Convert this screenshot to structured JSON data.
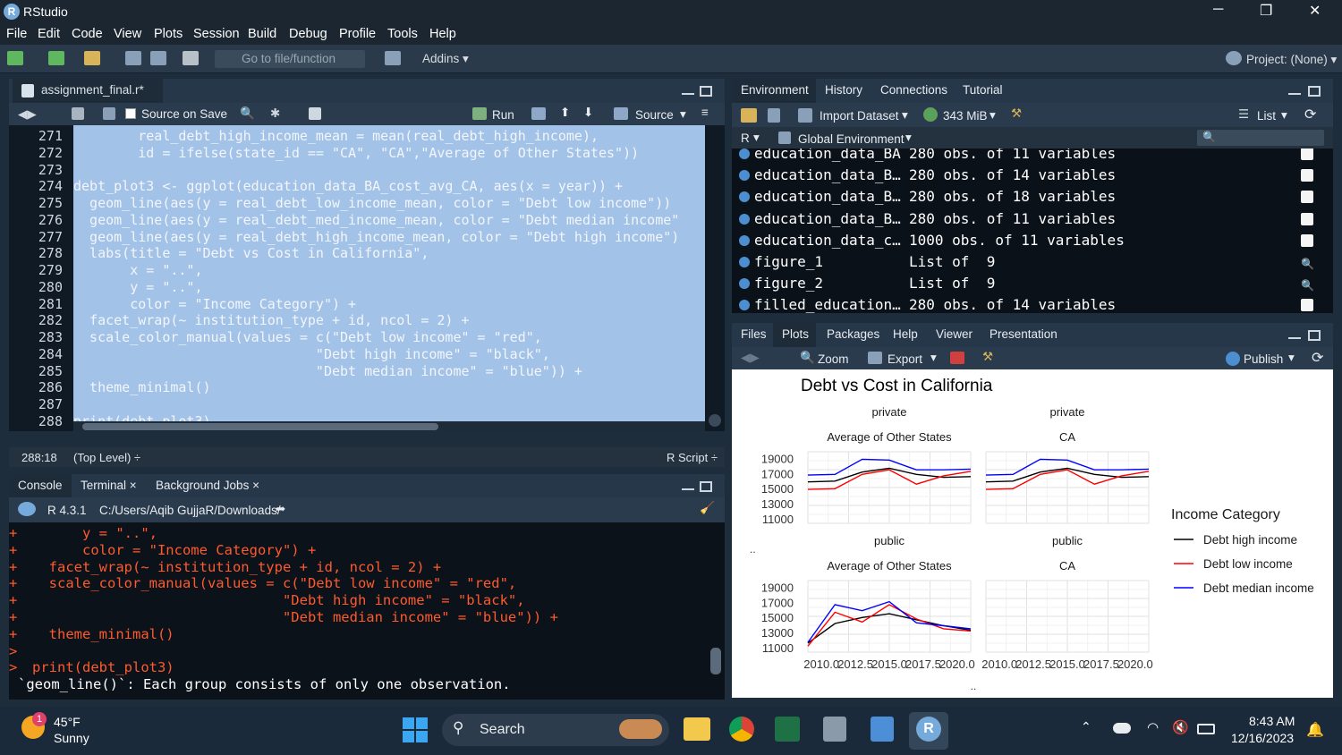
{
  "window": {
    "app_title": "RStudio",
    "logo_letter": "R",
    "minimize": "─",
    "maximize": "❐",
    "close": "✕"
  },
  "menu": [
    "File",
    "Edit",
    "Code",
    "View",
    "Plots",
    "Session",
    "Build",
    "Debug",
    "Profile",
    "Tools",
    "Help"
  ],
  "toolbar": {
    "goto": "Go to file/function",
    "addins": "Addins ▾",
    "project": "Project: (None) ▾"
  },
  "editor": {
    "tab": "assignment_final.r*",
    "source_on_save": "Source on Save",
    "run": "Run",
    "source": "Source",
    "lines": [
      {
        "n": "271",
        "code": "        real_debt_high_income_mean = mean(real_debt_high_income),"
      },
      {
        "n": "272",
        "code": "        id = ifelse(state_id == \"CA\", \"CA\",\"Average of Other States\"))"
      },
      {
        "n": "273",
        "code": ""
      },
      {
        "n": "274",
        "code": "debt_plot3 <- ggplot(education_data_BA_cost_avg_CA, aes(x = year)) +"
      },
      {
        "n": "275",
        "code": "  geom_line(aes(y = real_debt_low_income_mean, color = \"Debt low income\"))"
      },
      {
        "n": "276",
        "code": "  geom_line(aes(y = real_debt_med_income_mean, color = \"Debt median income\""
      },
      {
        "n": "277",
        "code": "  geom_line(aes(y = real_debt_high_income_mean, color = \"Debt high income\")"
      },
      {
        "n": "278",
        "code": "  labs(title = \"Debt vs Cost in California\","
      },
      {
        "n": "279",
        "code": "       x = \"..\","
      },
      {
        "n": "280",
        "code": "       y = \"..\","
      },
      {
        "n": "281",
        "code": "       color = \"Income Category\") +"
      },
      {
        "n": "282",
        "code": "  facet_wrap(~ institution_type + id, ncol = 2) +"
      },
      {
        "n": "283",
        "code": "  scale_color_manual(values = c(\"Debt low income\" = \"red\","
      },
      {
        "n": "284",
        "code": "                              \"Debt high income\" = \"black\","
      },
      {
        "n": "285",
        "code": "                              \"Debt median income\" = \"blue\")) +"
      },
      {
        "n": "286",
        "code": "  theme_minimal()"
      },
      {
        "n": "287",
        "code": ""
      },
      {
        "n": "288",
        "code": "print(debt_plot3)"
      }
    ],
    "status_pos": "288:18",
    "status_scope": "(Top Level) ÷",
    "status_type": "R Script ÷"
  },
  "console": {
    "tabs": [
      "Console",
      "Terminal ×",
      "Background Jobs ×"
    ],
    "r_version": "R 4.3.1",
    "path": "C:/Users/Aqib GujjaR/Downloads/",
    "lines": [
      {
        "p": "+",
        "t": "      y = \"..\","
      },
      {
        "p": "+",
        "t": "      color = \"Income Category\") +"
      },
      {
        "p": "+",
        "t": "  facet_wrap(~ institution_type + id, ncol = 2) +"
      },
      {
        "p": "+",
        "t": "  scale_color_manual(values = c(\"Debt low income\" = \"red\","
      },
      {
        "p": "+",
        "t": "                              \"Debt high income\" = \"black\","
      },
      {
        "p": "+",
        "t": "                              \"Debt median income\" = \"blue\")) +"
      },
      {
        "p": "+",
        "t": "  theme_minimal()"
      },
      {
        "p": ">",
        "t": ""
      },
      {
        "p": ">",
        "t": "print(debt_plot3)"
      },
      {
        "p": "",
        "t": "`geom_line()`: Each group consists of only one observation."
      }
    ]
  },
  "environment": {
    "tabs": [
      "Environment",
      "History",
      "Connections",
      "Tutorial"
    ],
    "import": "Import Dataset",
    "memory": "343 MiB",
    "list_view": "List",
    "lang": "R",
    "scope": "Global Environment",
    "rows": [
      {
        "name": "education_data_BA",
        "value": "280 obs. of 11 variables"
      },
      {
        "name": "education_data_B…",
        "value": "280 obs. of 14 variables"
      },
      {
        "name": "education_data_B…",
        "value": "280 obs. of 18 variables"
      },
      {
        "name": "education_data_B…",
        "value": "280 obs. of 11 variables"
      },
      {
        "name": "education_data_c…",
        "value": "1000 obs. of 11 variables"
      },
      {
        "name": "figure_1",
        "value": "List of  9"
      },
      {
        "name": "figure_2",
        "value": "List of  9"
      },
      {
        "name": "filled_education…",
        "value": "280 obs. of 14 variables"
      }
    ]
  },
  "files": {
    "tabs": [
      "Files",
      "Plots",
      "Packages",
      "Help",
      "Viewer",
      "Presentation"
    ],
    "zoom": "Zoom",
    "export": "Export",
    "publish": "Publish"
  },
  "chart_data": {
    "type": "line",
    "title": "Debt vs Cost in California",
    "xlabel": "..",
    "ylabel": "..",
    "legend_title": "Income Category",
    "legend_position": "right",
    "x_ticks": [
      "2010.0",
      "2012.5",
      "2015.0",
      "2017.5",
      "2020.0"
    ],
    "y_ticks": [
      "11000",
      "13000",
      "15000",
      "17000",
      "19000"
    ],
    "xlim": [
      2009,
      2021
    ],
    "ylim": [
      10500,
      20000
    ],
    "panels": [
      {
        "strip": [
          "private",
          "Average of Other States"
        ],
        "series": [
          {
            "name": "Debt high income",
            "color": "#000000",
            "x": [
              2009,
              2011,
              2013,
              2015,
              2017,
              2019,
              2021
            ],
            "y": [
              16000,
              16100,
              17300,
              17800,
              17000,
              16600,
              16700
            ]
          },
          {
            "name": "Debt low income",
            "color": "#ff0000",
            "x": [
              2009,
              2011,
              2013,
              2015,
              2017,
              2019,
              2021
            ],
            "y": [
              15000,
              15100,
              17000,
              17600,
              15700,
              16800,
              17400
            ]
          },
          {
            "name": "Debt median income",
            "color": "#0000ff",
            "x": [
              2009,
              2011,
              2013,
              2015,
              2017,
              2019,
              2021
            ],
            "y": [
              16900,
              17000,
              19000,
              18900,
              17600,
              17600,
              17700
            ]
          }
        ]
      },
      {
        "strip": [
          "private",
          "CA"
        ],
        "series": [
          {
            "name": "Debt high income",
            "color": "#000000",
            "x": [
              2009,
              2011,
              2013,
              2015,
              2017,
              2019,
              2021
            ],
            "y": [
              16000,
              16100,
              17300,
              17800,
              17000,
              16600,
              16700
            ]
          },
          {
            "name": "Debt low income",
            "color": "#ff0000",
            "x": [
              2009,
              2011,
              2013,
              2015,
              2017,
              2019,
              2021
            ],
            "y": [
              15000,
              15100,
              17000,
              17600,
              15700,
              16800,
              17400
            ]
          },
          {
            "name": "Debt median income",
            "color": "#0000ff",
            "x": [
              2009,
              2011,
              2013,
              2015,
              2017,
              2019,
              2021
            ],
            "y": [
              16900,
              17000,
              19000,
              18900,
              17600,
              17600,
              17700
            ]
          }
        ]
      },
      {
        "strip": [
          "public",
          "Average of Other States"
        ],
        "series": [
          {
            "name": "Debt high income",
            "color": "#000000",
            "x": [
              2009,
              2011,
              2013,
              2015,
              2017,
              2019,
              2021
            ],
            "y": [
              11700,
              14300,
              15100,
              15600,
              14800,
              14000,
              13400
            ]
          },
          {
            "name": "Debt low income",
            "color": "#ff0000",
            "x": [
              2009,
              2011,
              2013,
              2015,
              2017,
              2019,
              2021
            ],
            "y": [
              11300,
              15800,
              14500,
              16800,
              14900,
              13600,
              13300
            ]
          },
          {
            "name": "Debt median income",
            "color": "#0000ff",
            "x": [
              2009,
              2011,
              2013,
              2015,
              2017,
              2019,
              2021
            ],
            "y": [
              11800,
              16800,
              16000,
              17200,
              14400,
              14000,
              13600
            ]
          }
        ]
      },
      {
        "strip": [
          "public",
          "CA"
        ],
        "series": []
      }
    ]
  },
  "taskbar": {
    "temp": "45°F",
    "weather": "Sunny",
    "badge": "1",
    "search": "Search",
    "time": "8:43 AM",
    "date": "12/16/2023"
  }
}
